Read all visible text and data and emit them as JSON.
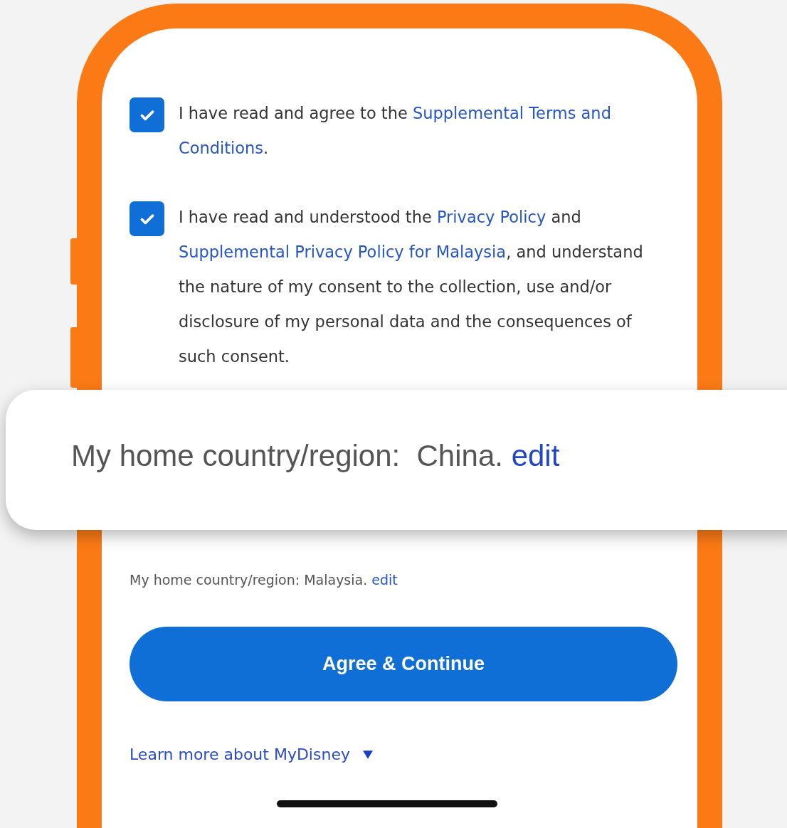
{
  "consents": [
    {
      "checked": true,
      "segments": [
        {
          "kind": "plain",
          "text": "I have read and agree to the "
        },
        {
          "kind": "link",
          "text": "Supplemental Terms and"
        },
        {
          "kind": "link",
          "text": "Conditions"
        },
        {
          "kind": "plain",
          "text": "."
        }
      ]
    },
    {
      "checked": true,
      "segments": [
        {
          "kind": "plain",
          "text": "I have read and understood the "
        },
        {
          "kind": "link",
          "text": "Privacy Policy"
        },
        {
          "kind": "plain",
          "text": " and "
        },
        {
          "kind": "link",
          "text": "Supplemental Privacy Policy for Malaysia"
        },
        {
          "kind": "plain",
          "text": ", and understand the nature of my consent to the collection, use and/or disclosure of my personal data and the consequences of such consent."
        }
      ]
    }
  ],
  "home_country": {
    "label": "My home country/region: Malaysia.",
    "link": "edit"
  },
  "primary_button": "Agree & Continue",
  "learn_more": "Learn more about MyDisney",
  "callout": {
    "label": "My home country/region:",
    "value": "China.",
    "link": "edit"
  }
}
